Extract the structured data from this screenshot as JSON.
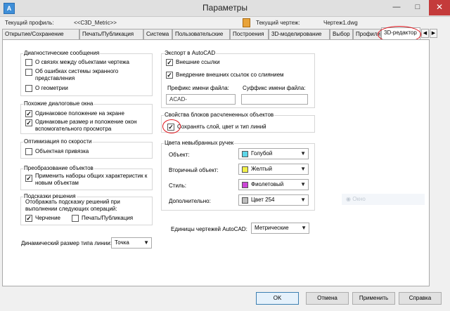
{
  "window": {
    "title": "Параметры",
    "app_icon": "A"
  },
  "profile": {
    "label": "Текущий профиль:",
    "value": "<<C3D_Metric>>",
    "drawing_label": "Текущий чертеж:",
    "drawing_value": "Чертеж1.dwg"
  },
  "tabs": [
    "Открытие/Сохранение",
    "Печать/Публикация",
    "Система",
    "Пользовательские",
    "Построения",
    "3D-моделирование",
    "Выбор",
    "Профили",
    "3D-редактор"
  ],
  "diag": {
    "title": "Диагностические сообщения",
    "items": [
      "О связях между объектами чертежа",
      "Об ошибках системы экранного представления",
      "О геометрии"
    ]
  },
  "similar": {
    "title": "Похожие диалоговые окна",
    "items": [
      "Одинаковое положение на экране",
      "Одинаковые размер и положение окон вспомогательного просмотра"
    ]
  },
  "speed": {
    "title": "Оптимизация по скорости",
    "items": [
      "Объектная привязка"
    ]
  },
  "convert": {
    "title": "Преобразование объектов",
    "items": [
      "Применить наборы общих характеристик к новым объектам"
    ]
  },
  "hints": {
    "title": "Подсказки решения",
    "desc": "Отображать подсказку решений при выполнении следующих операций:",
    "items": [
      "Черчение",
      "Печать/Публикация"
    ]
  },
  "linetype": {
    "label": "Динамический размер типа линии:",
    "value": "Точка"
  },
  "export": {
    "title": "Экспорт в AutoCAD",
    "items": [
      "Внешние ссылки",
      "Внедрение внешних ссылок со слиянием"
    ],
    "prefix_label": "Префикс имени файла:",
    "prefix_value": "ACAD-",
    "suffix_label": "Суффикс имени файла:",
    "suffix_value": ""
  },
  "blocks": {
    "title": "Свойства блоков расчлененных объектов",
    "items": [
      "Сохранять слой, цвет и тип линий"
    ]
  },
  "grips": {
    "title": "Цвета невыбранных ручек",
    "rows": [
      {
        "label": "Объект:",
        "value": "Голубой",
        "color": "#5ed6e8"
      },
      {
        "label": "Вторичный объект:",
        "value": "Желтый",
        "color": "#f2f04a"
      },
      {
        "label": "Стиль:",
        "value": "Фиолетовый",
        "color": "#cc45d6"
      },
      {
        "label": "Дополнительно:",
        "value": "Цвет 254",
        "color": "#bebebe"
      }
    ]
  },
  "units": {
    "label": "Единицы чертежей AutoCAD:",
    "value": "Метрические"
  },
  "ghost": {
    "label": "Окно"
  },
  "buttons": {
    "ok": "OK",
    "cancel": "Отмена",
    "apply": "Применить",
    "help": "Справка"
  }
}
